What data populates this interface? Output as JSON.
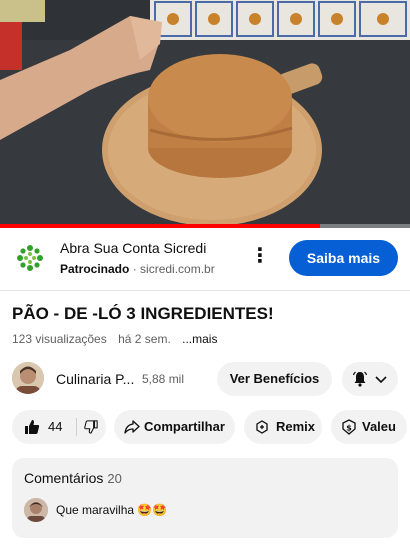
{
  "video": {
    "progress_fraction": 0.78,
    "progress_color": "#ff0000"
  },
  "ad": {
    "title": "Abra Sua Conta Sicredi",
    "sponsored_label": "Patrocinado",
    "separator": "·",
    "domain": "sicredi.com.br",
    "menu_icon": "more-vert-icon",
    "cta_label": "Saiba mais",
    "cta_color": "#065fd4",
    "logo_color": "#33a02c"
  },
  "video_info": {
    "title": "PÃO - DE -LÓ 3 INGREDIENTES!",
    "views": "123 visualizações",
    "age": "há 2 sem.",
    "more_label": "...mais"
  },
  "channel": {
    "name": "Culinaria P...",
    "subscribers": "5,88 mil",
    "benefits_label": "Ver Benefícios",
    "bell_icon": "bell-icon",
    "chevron_icon": "chevron-down-icon"
  },
  "actions": {
    "like_count": "44",
    "share_label": "Compartilhar",
    "remix_label": "Remix",
    "valeu_label": "Valeu"
  },
  "comments": {
    "header": "Comentários",
    "count": "20",
    "top_comment": "Que maravilha 🤩🤩"
  }
}
